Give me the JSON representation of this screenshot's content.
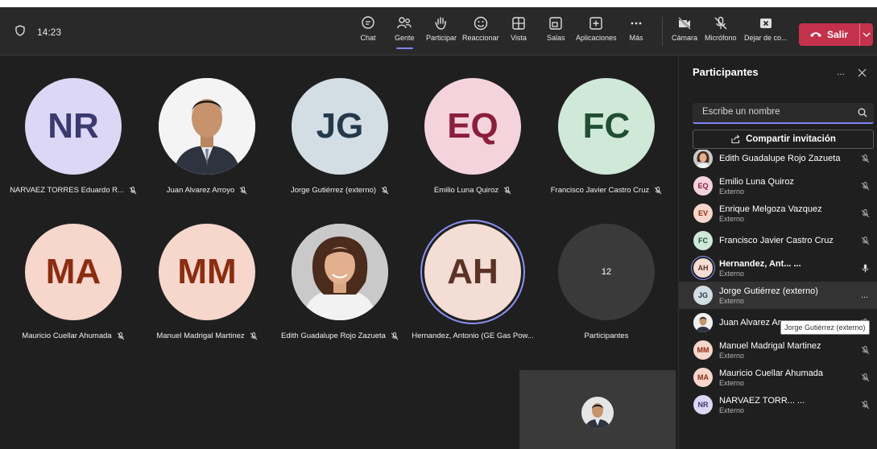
{
  "header": {
    "time": "14:23",
    "toolbar": {
      "chat": "Chat",
      "people": "Gente",
      "raise": "Participar",
      "react": "Reaccionar",
      "view": "Vista",
      "rooms": "Salas",
      "apps": "Aplicaciones",
      "more": "Más",
      "camera": "Cámara",
      "mic": "Micrófono",
      "share": "Dejar de co...",
      "leave": "Salir"
    }
  },
  "stage": {
    "tiles": [
      {
        "initials": "NR",
        "name": "NARVAEZ TORRES Eduardo R...",
        "bg": "#dcd7f5",
        "fg": "#3b3a6e"
      },
      {
        "initials": "",
        "name": "Juan Alvarez Arroyo",
        "photo": "man"
      },
      {
        "initials": "JG",
        "name": "Jorge Gutiérrez (externo)",
        "bg": "#d3dde4",
        "fg": "#243a4a"
      },
      {
        "initials": "EQ",
        "name": "Emilio Luna Quiroz",
        "bg": "#f5d3dd",
        "fg": "#8a1f3b"
      },
      {
        "initials": "FC",
        "name": "Francisco Javier Castro Cruz",
        "bg": "#cfe8d8",
        "fg": "#1f4e34"
      },
      {
        "initials": "MA",
        "name": "Mauricio Cuellar Ahumada",
        "bg": "#f7d6cc",
        "fg": "#8a2d10"
      },
      {
        "initials": "MM",
        "name": "Manuel Madrigal Martinez",
        "bg": "#f7d6cc",
        "fg": "#8a2d10"
      },
      {
        "initials": "",
        "name": "Edith Guadalupe Rojo Zazueta",
        "photo": "woman"
      },
      {
        "initials": "AH",
        "name": "Hernandez, Antonio (GE Gas Pow...",
        "bg": "#f3ddd5",
        "fg": "#5a3326"
      },
      {
        "initials": "12",
        "name": "Participantes",
        "bg": "#3a3a3a",
        "fg": "#ffffff"
      }
    ]
  },
  "panel": {
    "title": "Participantes",
    "search_placeholder": "Escribe un nombre",
    "invite": "Compartir invitación",
    "participants": [
      {
        "initials": "",
        "name": "Edith Guadalupe Rojo Zazueta",
        "sub": "",
        "photo": "woman",
        "mic": "off"
      },
      {
        "initials": "EQ",
        "name": "Emilio Luna Quiroz",
        "sub": "Externo",
        "bg": "#f5d3dd",
        "fg": "#8a1f3b",
        "mic": "off"
      },
      {
        "initials": "EV",
        "name": "Enrique Melgoza Vazquez",
        "sub": "Externo",
        "bg": "#f7d6cc",
        "fg": "#8a2d10",
        "mic": "off"
      },
      {
        "initials": "FC",
        "name": "Francisco Javier Castro Cruz",
        "sub": "",
        "bg": "#cfe8d8",
        "fg": "#1f4e34",
        "mic": "off"
      },
      {
        "initials": "AH",
        "name": "Hernandez, Ant... ...",
        "sub": "Externo",
        "bg": "#f3ddd5",
        "fg": "#5a3326",
        "mic": "on",
        "bold": true
      },
      {
        "initials": "JG",
        "name": "Jorge Gutiérrez (externo)",
        "sub": "Externo",
        "bg": "#d3dde4",
        "fg": "#243a4a",
        "mic": "more"
      },
      {
        "initials": "",
        "name": "Juan Alvarez Arroyo",
        "sub": "",
        "photo": "man",
        "mic": "off"
      },
      {
        "initials": "MM",
        "name": "Manuel Madrigal Martinez",
        "sub": "Externo",
        "bg": "#f7d6cc",
        "fg": "#8a2d10",
        "mic": "off"
      },
      {
        "initials": "MA",
        "name": "Mauricio Cuellar Ahumada",
        "sub": "Externo",
        "bg": "#f7d6cc",
        "fg": "#8a2d10",
        "mic": "off"
      },
      {
        "initials": "NR",
        "name": "NARVAEZ TORR... ...",
        "sub": "Externo",
        "bg": "#dcd7f5",
        "fg": "#3b3a6e",
        "mic": "off"
      }
    ],
    "more_label": "...",
    "tooltip": "Jorge Gutiérrez (externo)"
  }
}
